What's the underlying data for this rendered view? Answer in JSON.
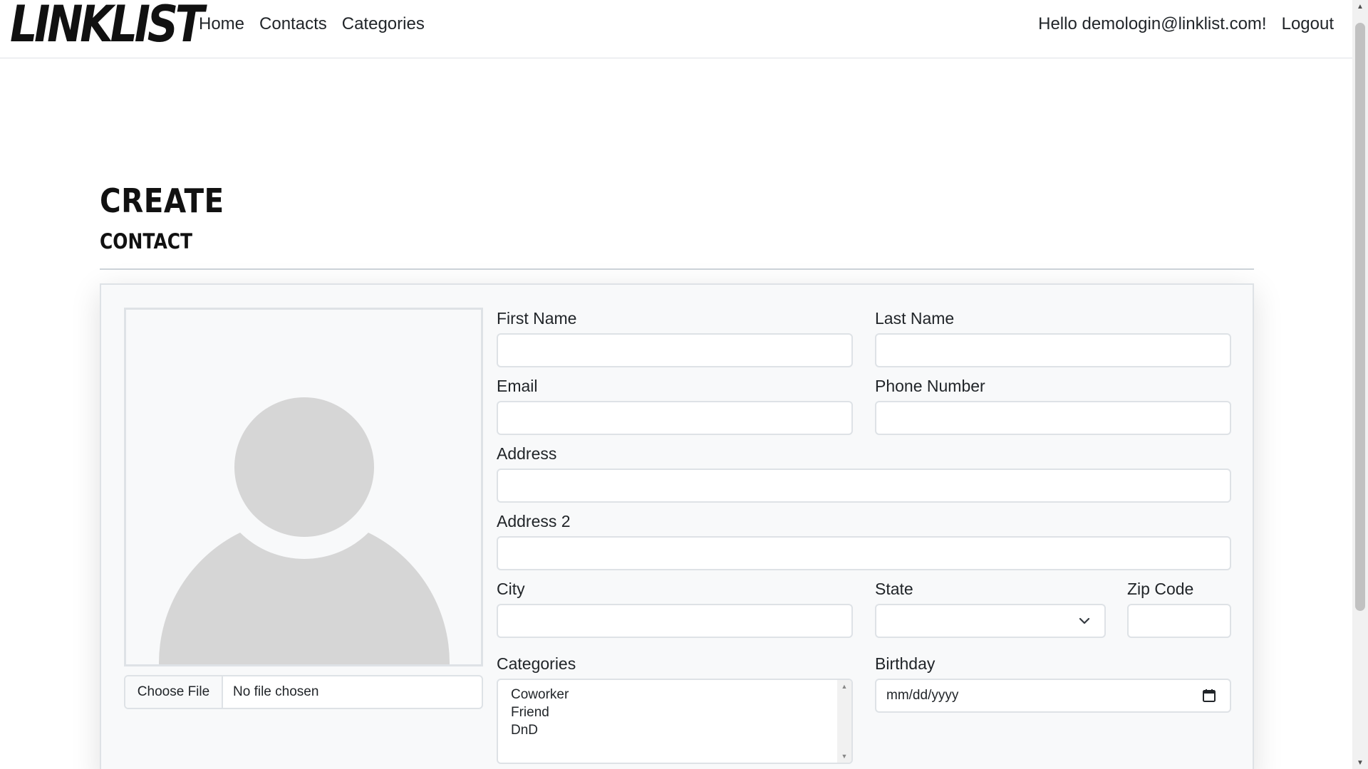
{
  "navbar": {
    "brand": "LINKLIST",
    "links": {
      "home": "Home",
      "contacts": "Contacts",
      "categories": "Categories"
    },
    "greeting": "Hello demologin@linklist.com!",
    "logout": "Logout"
  },
  "header": {
    "title": "CREATE",
    "subtitle": "CONTACT"
  },
  "form": {
    "photo": {
      "choose_file": "Choose File",
      "file_status": "No file chosen"
    },
    "first_name": {
      "label": "First Name",
      "value": ""
    },
    "last_name": {
      "label": "Last Name",
      "value": ""
    },
    "email": {
      "label": "Email",
      "value": ""
    },
    "phone": {
      "label": "Phone Number",
      "value": ""
    },
    "address": {
      "label": "Address",
      "value": ""
    },
    "address2": {
      "label": "Address 2",
      "value": ""
    },
    "city": {
      "label": "City",
      "value": ""
    },
    "state": {
      "label": "State",
      "value": ""
    },
    "zip": {
      "label": "Zip Code",
      "value": ""
    },
    "categories": {
      "label": "Categories",
      "options": [
        "Coworker",
        "Friend",
        "DnD"
      ]
    },
    "birthday": {
      "label": "Birthday",
      "placeholder": "mm/dd/yyyy"
    }
  },
  "icons": {
    "select_arrow": "chevron-down-icon",
    "calendar": "calendar-icon",
    "avatar": "person-placeholder-icon"
  },
  "colors": {
    "border": "#dee2e6",
    "card_bg": "#f8f9fa",
    "avatar_fill": "#d6d6d6"
  }
}
